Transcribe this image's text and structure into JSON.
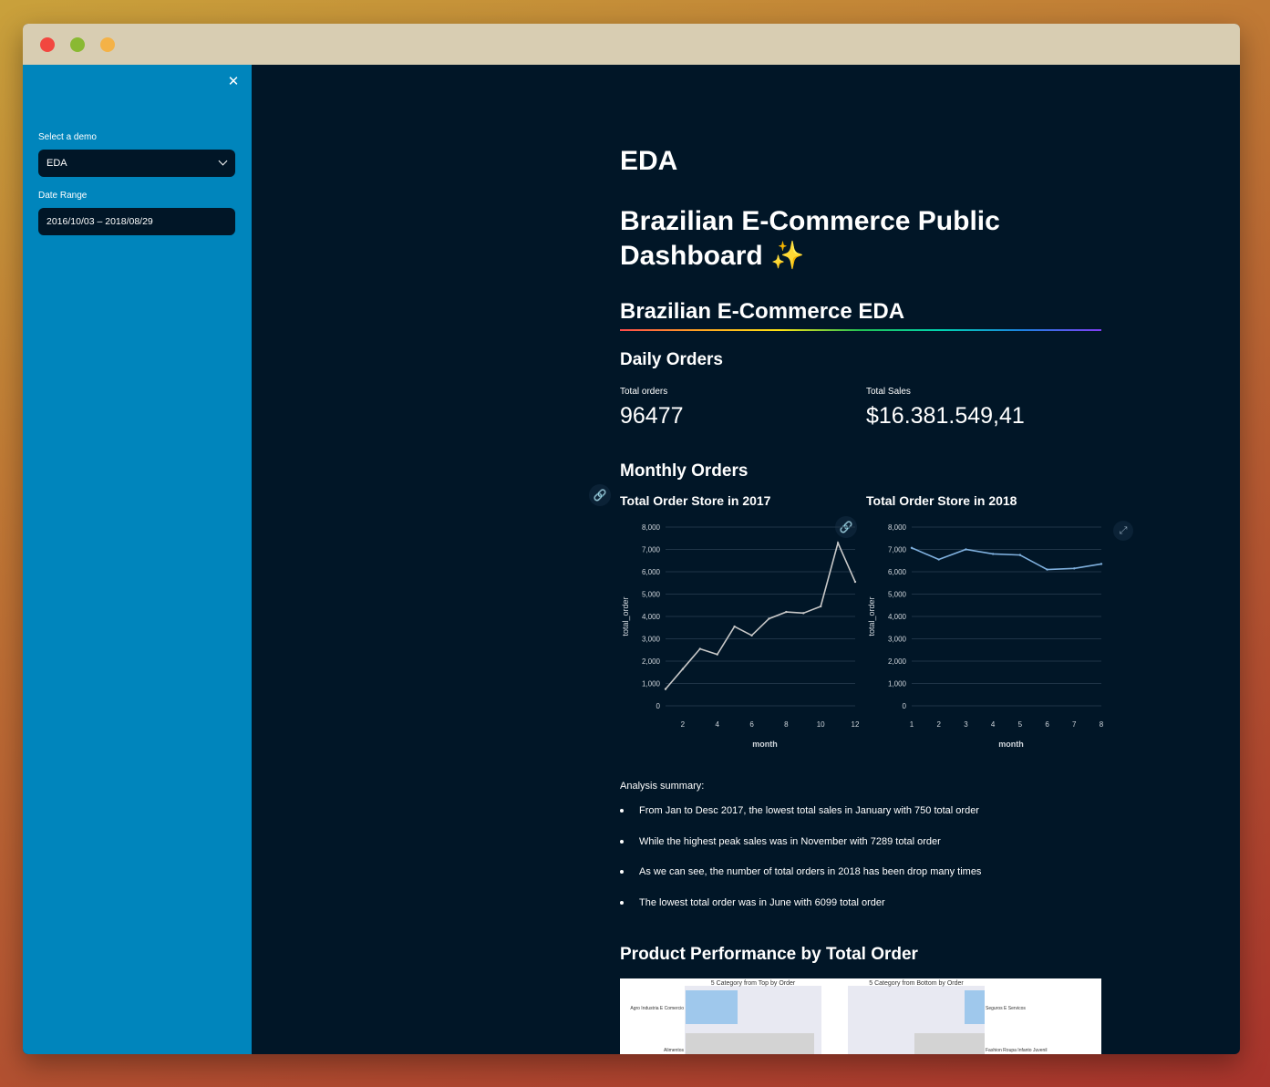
{
  "sidebar": {
    "close_glyph": "✕",
    "select_label": "Select a demo",
    "select_value": "EDA",
    "date_label": "Date Range",
    "date_value": "2016/10/03 – 2018/08/29"
  },
  "main": {
    "page_title": "EDA",
    "dashboard_title": "Brazilian E-Commerce Public Dashboard ✨",
    "section_title": "Brazilian E-Commerce EDA",
    "daily_title": "Daily Orders",
    "metrics": [
      {
        "label": "Total orders",
        "value": "96477"
      },
      {
        "label": "Total Sales",
        "value": "$16.381.549,41"
      }
    ],
    "monthly_title": "Monthly Orders",
    "summary_title": "Analysis summary:",
    "summary_items": [
      "From Jan to Desc 2017, the lowest total sales in January with 750 total order",
      "While the highest peak sales was in November with 7289 total order",
      "As we can see, the number of total orders in 2018 has been drop many times",
      "The lowest total order was in June with 6099 total order"
    ],
    "product_title": "Product Performance by Total Order",
    "product_chart": {
      "left_title": "5 Category from Top by Order",
      "right_title": "5 Category from Bottom by Order",
      "left_labels": [
        "Agro Industria E Comercio",
        "Alimentos"
      ],
      "right_labels": [
        "Seguros E Servicos",
        "Fashion Roupa Infanto Juvenil"
      ]
    }
  },
  "icons": {
    "link": "link-icon",
    "close": "close-icon",
    "chevron": "chevron-down-icon",
    "expand": "expand-icon"
  },
  "colors": {
    "sidebar_bg": "#0085bc",
    "main_bg": "#011627",
    "line_2017": "#c8c8c8",
    "line_2018": "#7fb0de"
  },
  "chart_data": [
    {
      "type": "line",
      "title": "Total Order Store in 2017",
      "xlabel": "month",
      "ylabel": "total_order",
      "x": [
        1,
        2,
        3,
        4,
        5,
        6,
        7,
        8,
        9,
        10,
        11,
        12
      ],
      "series": [
        {
          "values": [
            750,
            1650,
            2550,
            2300,
            3550,
            3150,
            3900,
            4200,
            4150,
            4450,
            7289,
            5550
          ]
        }
      ],
      "xticks": [
        2,
        4,
        6,
        8,
        10,
        12
      ],
      "yticks": [
        0,
        1000,
        2000,
        3000,
        4000,
        5000,
        6000,
        7000,
        8000
      ],
      "ytick_labels": [
        "0",
        "1,000",
        "2,000",
        "3,000",
        "4,000",
        "5,000",
        "6,000",
        "7,000",
        "8,000"
      ],
      "ylim": [
        0,
        8000
      ],
      "xlim": [
        1,
        12
      ],
      "grid": true
    },
    {
      "type": "line",
      "title": "Total Order Store in 2018",
      "xlabel": "month",
      "ylabel": "total_order",
      "x": [
        1,
        2,
        3,
        4,
        5,
        6,
        7,
        8
      ],
      "series": [
        {
          "values": [
            7070,
            6550,
            7000,
            6800,
            6750,
            6099,
            6150,
            6350
          ]
        }
      ],
      "xticks": [
        1,
        2,
        3,
        4,
        5,
        6,
        7,
        8
      ],
      "yticks": [
        0,
        1000,
        2000,
        3000,
        4000,
        5000,
        6000,
        7000,
        8000
      ],
      "ytick_labels": [
        "0",
        "1,000",
        "2,000",
        "3,000",
        "4,000",
        "5,000",
        "6,000",
        "7,000",
        "8,000"
      ],
      "ylim": [
        0,
        8000
      ],
      "xlim": [
        1,
        8
      ],
      "grid": true
    }
  ]
}
